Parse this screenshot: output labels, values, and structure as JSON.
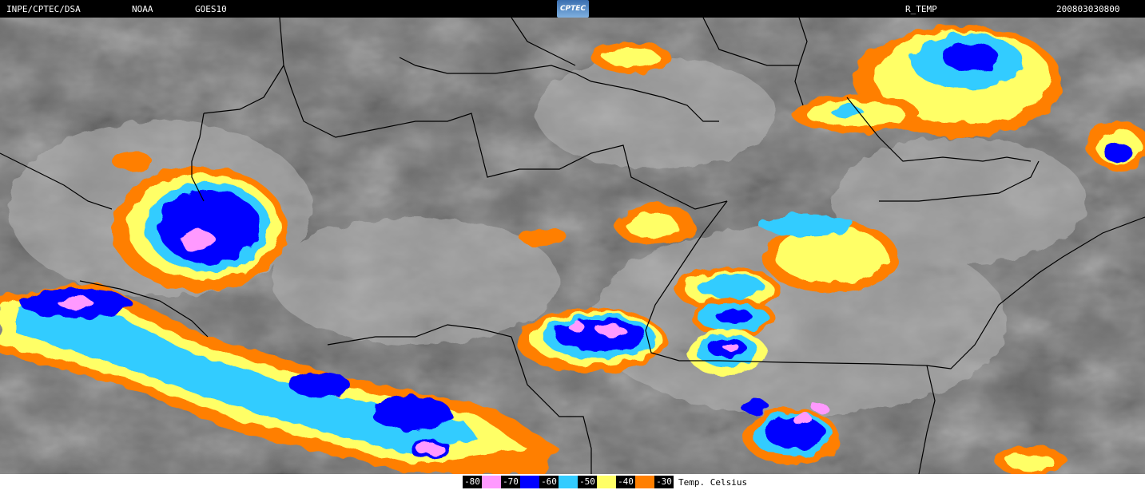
{
  "header": {
    "agency": "INPE/CPTEC/DSA",
    "source": "NOAA",
    "satellite": "GOES10",
    "logo_text": "CPTEC",
    "product": "R_TEMP",
    "timestamp": "200803030800"
  },
  "legend": {
    "title": "Temp. Celsius",
    "levels": [
      {
        "label": "-80",
        "color": "#ff99ff"
      },
      {
        "label": "-70",
        "color": "#0000ff"
      },
      {
        "label": "-60",
        "color": "#33ccff"
      },
      {
        "label": "-50",
        "color": "#ffff66"
      },
      {
        "label": "-40",
        "color": "#ff7f00"
      },
      {
        "label": "-30",
        "color": "#000000"
      }
    ]
  },
  "colors": {
    "background_dark": "#5a5a5a",
    "background_light": "#a8a8a8",
    "border_lines": "#000000"
  }
}
